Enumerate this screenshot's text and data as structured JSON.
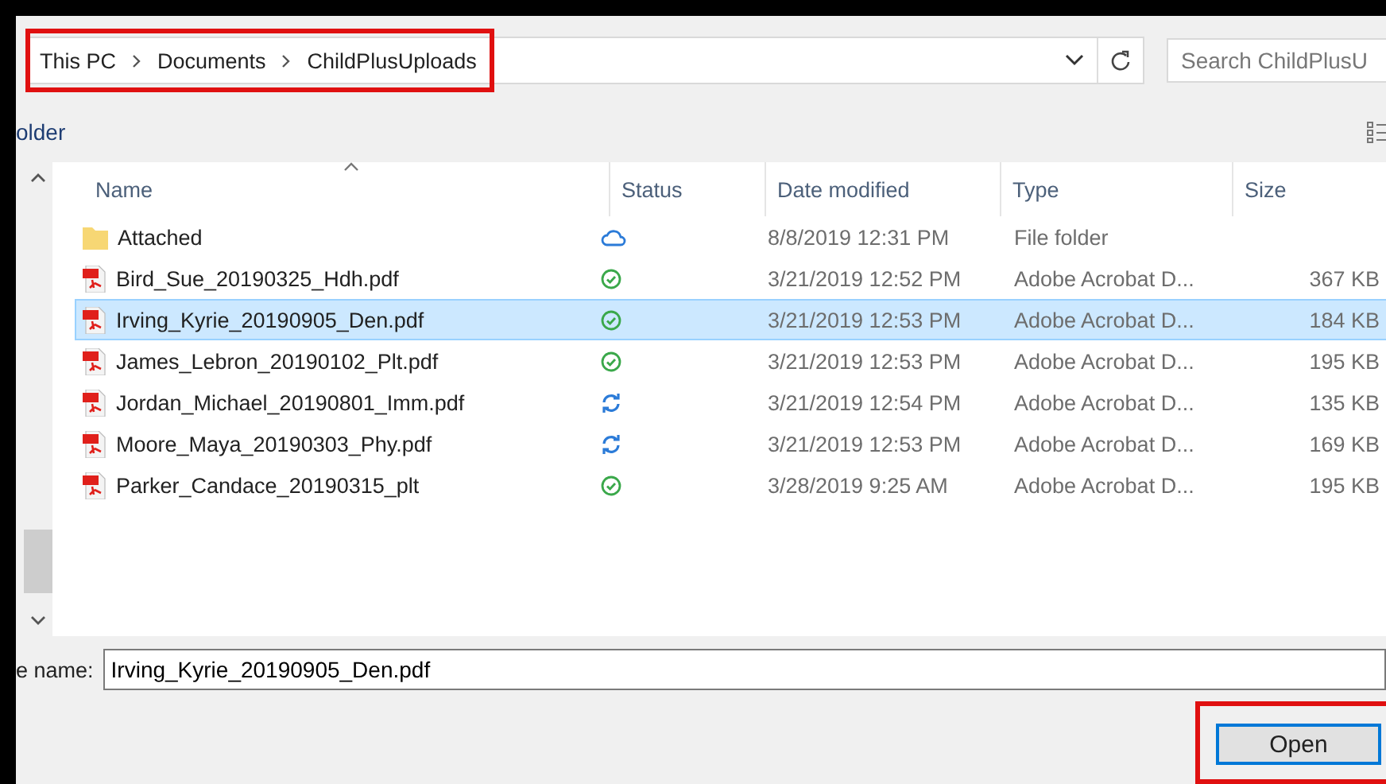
{
  "address_bar": {
    "crumbs": [
      "This PC",
      "Documents",
      "ChildPlusUploads"
    ],
    "highlighted": true
  },
  "search": {
    "placeholder": "Search ChildPlusU"
  },
  "toolbar": {
    "label": "older"
  },
  "table": {
    "columns": [
      "Name",
      "Status",
      "Date modified",
      "Type",
      "Size"
    ],
    "rows": [
      {
        "kind": "folder",
        "name": "Attached",
        "status": {
          "kind": "cloud"
        },
        "date": "8/8/2019 12:31 PM",
        "type": "File folder",
        "selected": false
      },
      {
        "kind": "pdf",
        "name": "Bird_Sue_20190325_Hdh.pdf",
        "status": {
          "kind": "synced"
        },
        "date": "3/21/2019 12:52 PM",
        "type": "Adobe Acrobat D...",
        "size": "367 KB",
        "selected": false
      },
      {
        "kind": "pdf",
        "name": "Irving_Kyrie_20190905_Den.pdf",
        "status": {
          "kind": "synced"
        },
        "date": "3/21/2019 12:53 PM",
        "type": "Adobe Acrobat D...",
        "size": "184 KB",
        "selected": true
      },
      {
        "kind": "pdf",
        "name": "James_Lebron_20190102_Plt.pdf",
        "status": {
          "kind": "synced"
        },
        "date": "3/21/2019 12:53 PM",
        "type": "Adobe Acrobat D...",
        "size": "195 KB",
        "selected": false
      },
      {
        "kind": "pdf",
        "name": "Jordan_Michael_20190801_Imm.pdf",
        "status": {
          "kind": "syncing"
        },
        "date": "3/21/2019 12:54 PM",
        "type": "Adobe Acrobat D...",
        "size": "135 KB",
        "selected": false
      },
      {
        "kind": "pdf",
        "name": "Moore_Maya_20190303_Phy.pdf",
        "status": {
          "kind": "syncing"
        },
        "date": "3/21/2019 12:53 PM",
        "type": "Adobe Acrobat D...",
        "size": "169 KB",
        "selected": false
      },
      {
        "kind": "pdf",
        "name": "Parker_Candace_20190315_plt",
        "status": {
          "kind": "synced"
        },
        "date": "3/28/2019 9:25 AM",
        "type": "Adobe Acrobat D...",
        "size": "195 KB",
        "selected": false
      }
    ]
  },
  "file_name": {
    "label": "e name:",
    "value": "Irving_Kyrie_20190905_Den.pdf"
  },
  "open_button": {
    "label": "Open",
    "highlighted": true
  }
}
